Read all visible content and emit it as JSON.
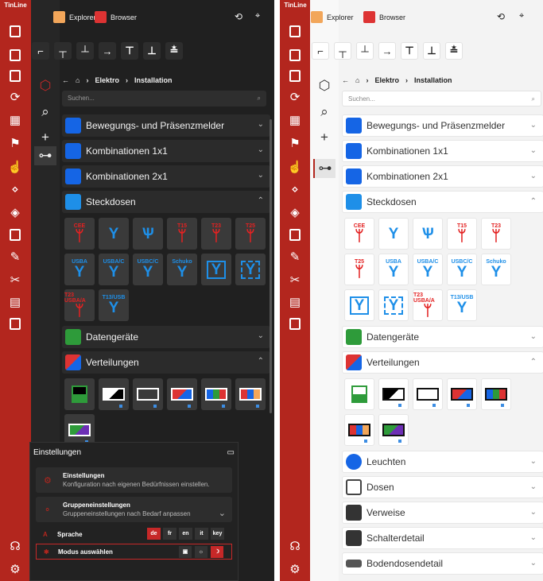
{
  "app_name": "TinLine",
  "topbar": {
    "explorer": "Explorer",
    "browser": "Browser"
  },
  "crumb": {
    "elektro": "Elektro",
    "installation": "Installation"
  },
  "search": {
    "placeholder": "Suchen..."
  },
  "categories": [
    "Bewegungs- und Präsenzmelder",
    "Kombinationen 1x1",
    "Kombinationen 2x1",
    "Steckdosen",
    "Datengeräte",
    "Verteilungen",
    "Leuchten",
    "Dosen",
    "Verweise",
    "Schalterdetail",
    "Bodendosendetail"
  ],
  "socket_tiles": [
    "CEE",
    "",
    "",
    "T15",
    "T23",
    "T25",
    "USBA",
    "USBA/C",
    "USBC/C",
    "Schuko",
    "",
    "",
    "T23 USBA/A",
    "T13/USB"
  ],
  "settings": {
    "title": "Einstellungen",
    "card1_title": "Einstellungen",
    "card1_sub": "Konfiguration nach eigenen Bedürfnissen einstellen.",
    "card2_title": "Gruppeneinstellungen",
    "card2_sub": "Gruppeneinstellungen nach Bedarf anpassen",
    "language": "Sprache",
    "mode": "Modus auswählen",
    "langs": [
      "de",
      "fr",
      "en",
      "it",
      "key"
    ]
  },
  "colors": {
    "brand": "#b3261e",
    "accent": "#1e8fe8",
    "socket_red": "#e32222"
  }
}
